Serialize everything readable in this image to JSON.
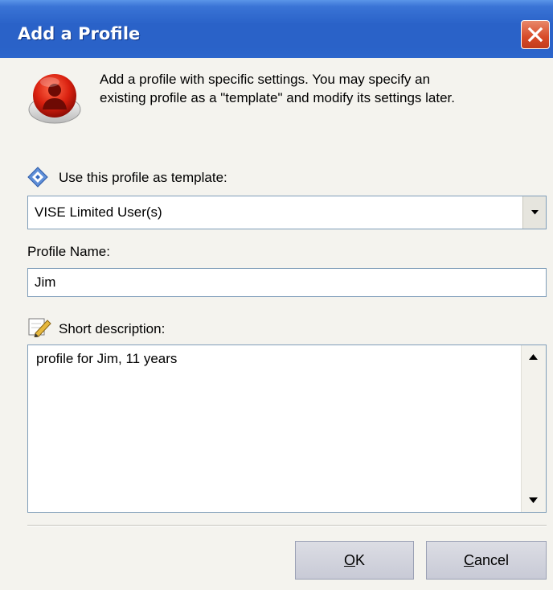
{
  "window": {
    "title": "Add a Profile"
  },
  "intro": {
    "line1": "Add a profile with specific settings. You may specify an",
    "line2": "existing profile as a \"template\" and modify its settings later."
  },
  "template": {
    "label": "Use this profile as template:",
    "selected": "VISE Limited User(s)"
  },
  "profile_name": {
    "label": "Profile Name:",
    "value": "Jim"
  },
  "description": {
    "label": "Short description:",
    "value": "profile for Jim, 11 years"
  },
  "buttons": {
    "ok_mnemonic": "O",
    "ok_rest": "K",
    "cancel_mnemonic": "C",
    "cancel_rest": "ancel"
  },
  "icons": {
    "header": "red-user-profile-icon",
    "template": "diamond-template-icon",
    "description": "pencil-notepad-icon",
    "close": "close-x-icon"
  },
  "colors": {
    "titlebar": "#2a62c8",
    "close_button": "#d74a27",
    "dialog_bg": "#f4f3ee",
    "field_border": "#7f9db9"
  }
}
